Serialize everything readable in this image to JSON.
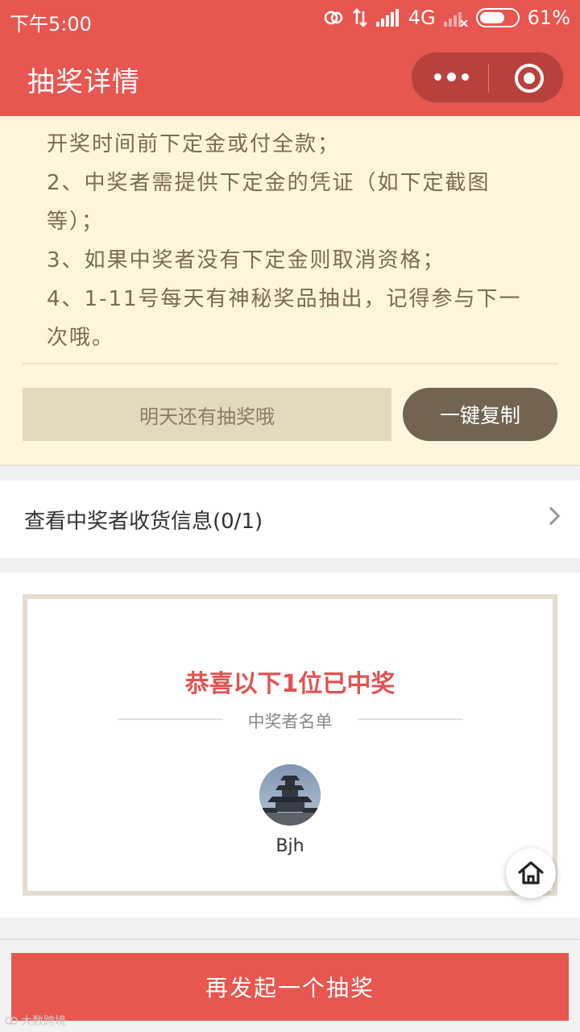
{
  "status_bar": {
    "time": "下午5:00",
    "network": "4G",
    "battery": "61%"
  },
  "header": {
    "title": "抽奖详情",
    "more_icon": "more-dots-icon",
    "close_icon": "target-icon"
  },
  "rules": {
    "lines": [
      "开奖时间前下定金或付全款；",
      "2、中奖者需提供下定金的凭证（如下定截图",
      "等）；",
      "3、如果中奖者没有下定金则取消资格；",
      "4、1-11号每天有神秘奖品抽出，记得参与下一",
      "次哦。"
    ],
    "tomorrow_label": "明天还有抽奖哦",
    "copy_label": "一键复制"
  },
  "winner_info": {
    "label": "查看中奖者收货信息(0/1)"
  },
  "winners": {
    "congrats": "恭喜以下1位已中奖",
    "list_title": "中奖者名单",
    "items": [
      {
        "name": "Bjh"
      }
    ]
  },
  "footer": {
    "button_label": "再发起一个抽奖",
    "watermark": "大数跨境"
  },
  "colors": {
    "brand_red": "#e85650",
    "cream": "#fdf5dc",
    "brown": "#726450"
  }
}
